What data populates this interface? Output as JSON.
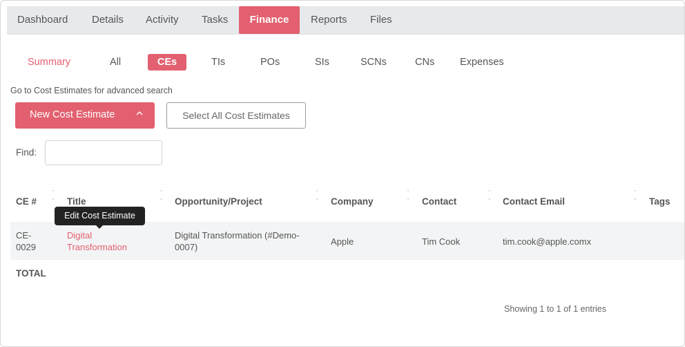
{
  "topnav": {
    "tabs": [
      {
        "label": "Dashboard"
      },
      {
        "label": "Details"
      },
      {
        "label": "Activity"
      },
      {
        "label": "Tasks"
      },
      {
        "label": "Finance"
      },
      {
        "label": "Reports"
      },
      {
        "label": "Files"
      }
    ],
    "active": "Finance"
  },
  "subtabs": {
    "items": [
      {
        "label": "Summary"
      },
      {
        "label": "All"
      },
      {
        "label": "CEs"
      },
      {
        "label": "TIs"
      },
      {
        "label": "POs"
      },
      {
        "label": "SIs"
      },
      {
        "label": "SCNs"
      },
      {
        "label": "CNs"
      },
      {
        "label": "Expenses"
      }
    ],
    "active": "CEs"
  },
  "goto_text": "Go to Cost Estimates for advanced search",
  "actions": {
    "new_label": "New Cost Estimate",
    "new_icon": "chevron-up-icon",
    "select_all_label": "Select All Cost Estimates"
  },
  "find": {
    "label": "Find:",
    "value": ""
  },
  "table": {
    "headers": [
      "CE #",
      "Title",
      "Opportunity/Project",
      "Company",
      "Contact",
      "Contact Email",
      "Tags"
    ],
    "rows": [
      {
        "ce_line1": "CE-",
        "ce_line2": "0029",
        "title_line1": "Digital",
        "title_line2": "Transformation",
        "project_line1": "Digital Transformation (#Demo-",
        "project_line2": "0007)",
        "company": "Apple",
        "contact": "Tim Cook",
        "email": "tim.cook@apple.comx",
        "tags": ""
      }
    ],
    "total_label": "TOTAL"
  },
  "tooltip": "Edit Cost Estimate",
  "footer": {
    "entries": "Showing 1 to 1 of 1 entries"
  },
  "colors": {
    "accent": "#e2606f",
    "nav_bg": "#e7eaed",
    "row_bg": "#f3f4f5"
  }
}
